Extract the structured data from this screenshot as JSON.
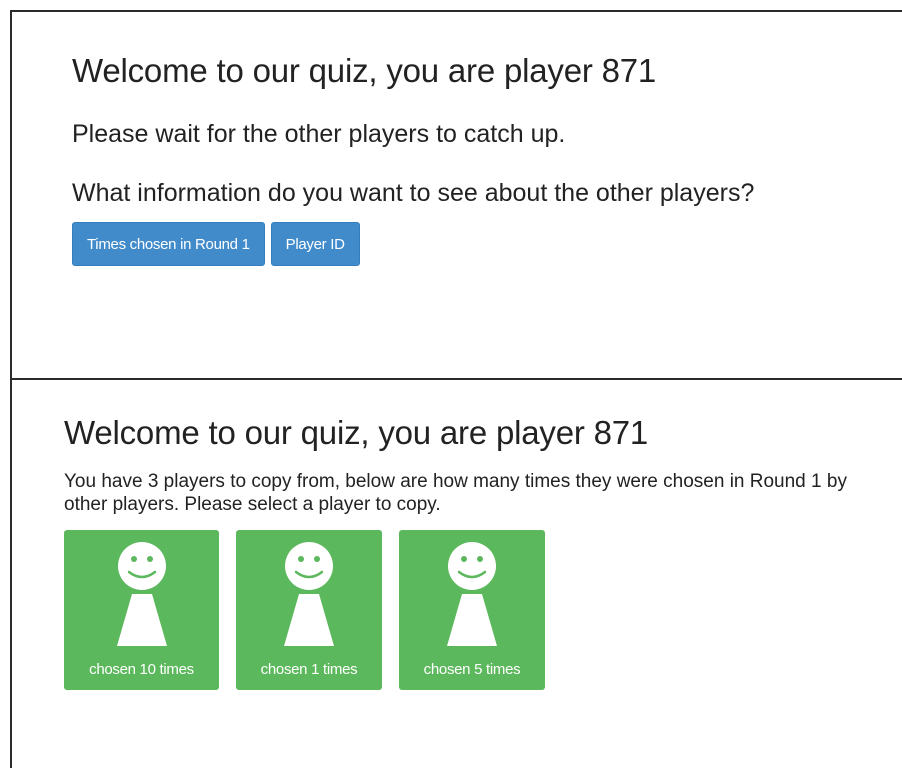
{
  "screen_one": {
    "title": "Welcome to our quiz, you are player 871",
    "wait_message": "Please wait for the other players to catch up.",
    "question": "What information do you want to see about the other players?",
    "buttons": [
      {
        "label": "Times chosen in Round 1"
      },
      {
        "label": "Player ID"
      }
    ]
  },
  "screen_two": {
    "title": "Welcome to our quiz, you are player 871",
    "instructions": "You have 3 players to copy from, below are how many times they were chosen in Round 1 by other players. Please select a player to copy.",
    "players": [
      {
        "label": "chosen 10 times",
        "icon": "player-icon"
      },
      {
        "label": "chosen 1 times",
        "icon": "player-icon"
      },
      {
        "label": "chosen 5 times",
        "icon": "player-icon"
      }
    ]
  },
  "colors": {
    "primary_button": "#428bca",
    "player_card": "#5cb85c",
    "text": "#222222"
  }
}
